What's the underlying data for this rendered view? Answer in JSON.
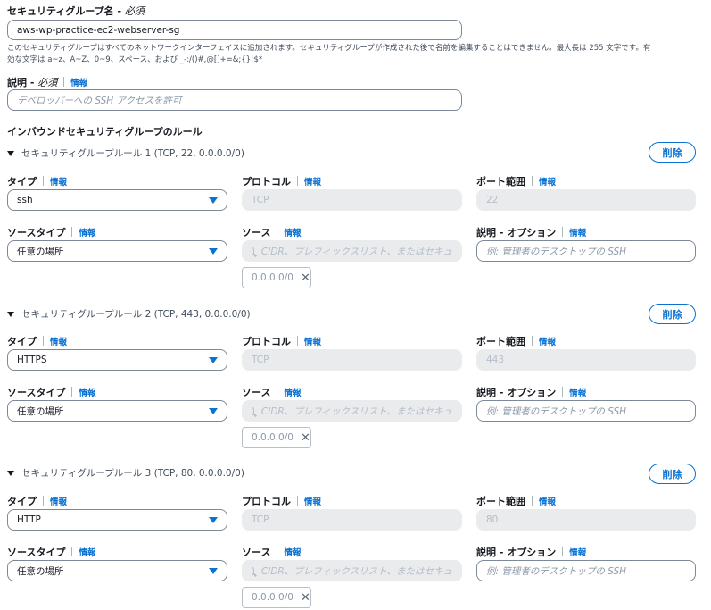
{
  "group_name": {
    "label": "セキュリティグループ名",
    "required": "必須",
    "value": "aws-wp-practice-ec2-webserver-sg",
    "hint_line1": "このセキュリティグループはすべてのネットワークインターフェイスに追加されます。セキュリティグループが作成された後で名前を編集することはできません。最大長は 255 文字です。有",
    "hint_line2": "効な文字は a~z、A~Z、0~9、スペース、および _-:/()#,@[]+=&;{}!$*"
  },
  "description": {
    "label": "説明",
    "required": "必須",
    "info": "情報",
    "placeholder": "デベロッパーへの SSH アクセスを許可"
  },
  "inbound_title": "インバウンドセキュリティグループのルール",
  "labels": {
    "type": "タイプ",
    "protocol": "プロトコル",
    "port_range": "ポート範囲",
    "source_type": "ソースタイプ",
    "source": "ソース",
    "desc_option": "説明",
    "option": "オプション",
    "info": "情報",
    "delete": "削除",
    "source_placeholder": "CIDR、プレフィックスリスト、またはセキュ",
    "desc_placeholder": "例: 管理者のデスクトップの SSH"
  },
  "rules": [
    {
      "title": "セキュリティグループルール 1 (TCP, 22, 0.0.0.0/0)",
      "type": "ssh",
      "protocol": "TCP",
      "port": "22",
      "source_type": "任意の場所",
      "cidr": "0.0.0.0/0"
    },
    {
      "title": "セキュリティグループルール 2 (TCP, 443, 0.0.0.0/0)",
      "type": "HTTPS",
      "protocol": "TCP",
      "port": "443",
      "source_type": "任意の場所",
      "cidr": "0.0.0.0/0"
    },
    {
      "title": "セキュリティグループルール 3 (TCP, 80, 0.0.0.0/0)",
      "type": "HTTP",
      "protocol": "TCP",
      "port": "80",
      "source_type": "任意の場所",
      "cidr": "0.0.0.0/0"
    }
  ]
}
